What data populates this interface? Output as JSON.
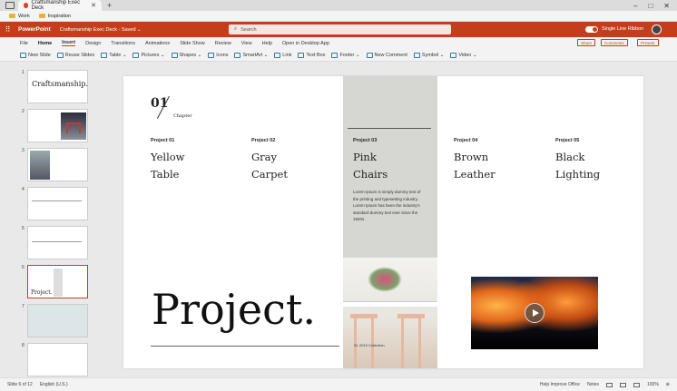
{
  "browser": {
    "tab_title": "Craftsmanship Exec Deck",
    "new_tab": "+",
    "window_controls": [
      "–",
      "□",
      "✕"
    ],
    "favorites": [
      "Work",
      "Inspiration"
    ]
  },
  "app": {
    "name": "PowerPoint",
    "doc_title": "Craftsmanship Exec Deck - Saved ⌄",
    "search_placeholder": "Search",
    "single_line_ribbon": "Single Line Ribbon"
  },
  "ribbon": {
    "tabs": [
      "File",
      "Home",
      "Insert",
      "Design",
      "Transitions",
      "Animations",
      "Slide Show",
      "Review",
      "View",
      "Help",
      "Open in Desktop App"
    ],
    "share": "Share",
    "comments": "Comments",
    "present": "Present",
    "tools": [
      "New Slide",
      "Reuse Slides",
      "Table ⌄",
      "Pictures ⌄",
      "Shapes ⌄",
      "Icons",
      "SmartArt ⌄",
      "Link",
      "Text Box",
      "Footer ⌄",
      "New Comment",
      "Symbol ⌄",
      "Video ⌄"
    ]
  },
  "thumbnails": {
    "numbers": [
      "1",
      "2",
      "3",
      "4",
      "5",
      "6",
      "7",
      "8"
    ],
    "slide1_title": "Craftsmanship.",
    "slide6_title": "Project."
  },
  "slide": {
    "chapter_num": "01",
    "chapter_label": "Chapter",
    "projects": [
      {
        "label": "Project 01",
        "line1": "Yellow",
        "line2": "Table"
      },
      {
        "label": "Project 02",
        "line1": "Gray",
        "line2": "Carpet"
      },
      {
        "label": "Project 03",
        "line1": "Pink",
        "line2": "Chairs"
      },
      {
        "label": "Project 04",
        "line1": "Brown",
        "line2": "Leather"
      },
      {
        "label": "Project 05",
        "line1": "Black",
        "line2": "Lighting"
      }
    ],
    "lorem": "Lorem Ipsum is simply dummy text of the printing and typesetting industry. Lorem Ipsum has been the industry's standard dummy text ever since the 1500s.",
    "big_title": "Project.",
    "photo_caption": "St. 2019 Collection"
  },
  "status": {
    "slide_of": "Slide 6 of 12",
    "language": "English (U.S.)",
    "help": "Help Improve Office",
    "notes": "Notes",
    "zoom": "100%"
  }
}
